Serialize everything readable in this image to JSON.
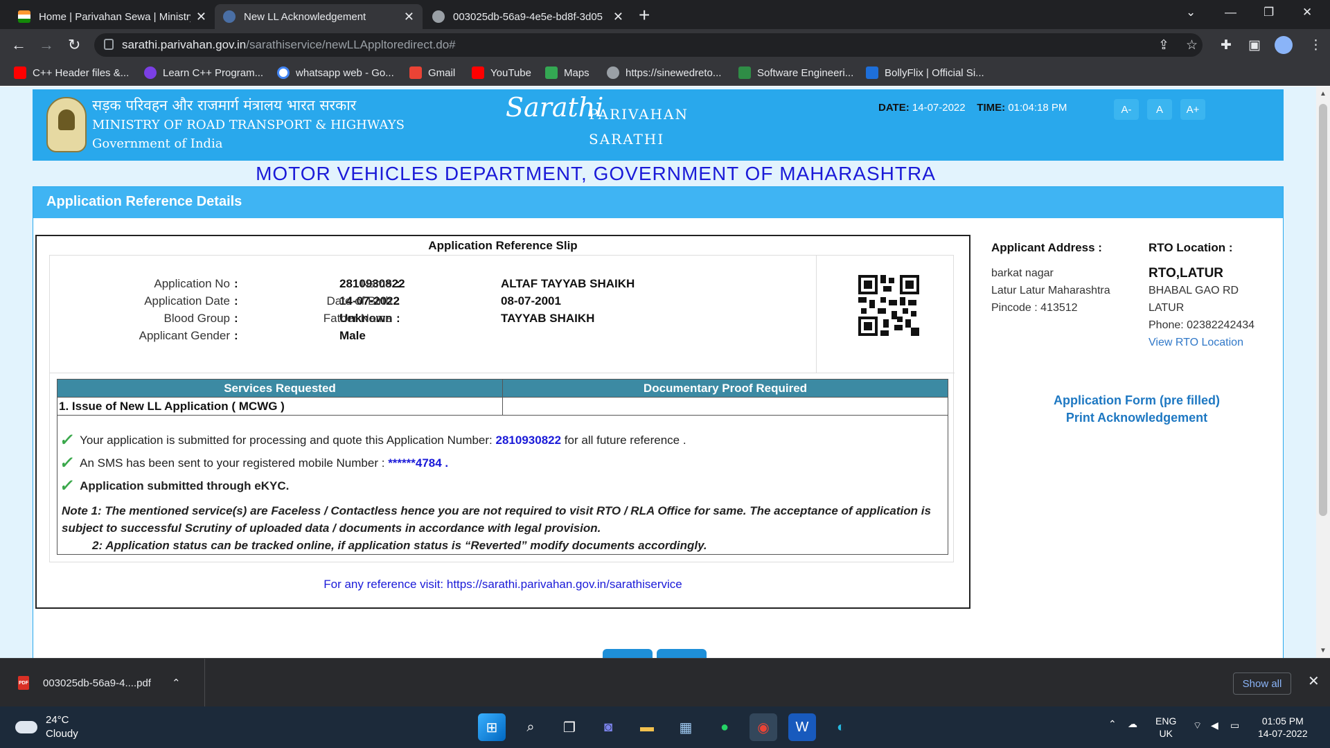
{
  "browser": {
    "tabs": [
      {
        "title": "Home | Parivahan Sewa | Ministry",
        "active": false
      },
      {
        "title": "New LL Acknowledgement",
        "active": true
      },
      {
        "title": "003025db-56a9-4e5e-bd8f-3d05",
        "active": false
      }
    ],
    "url_host": "sarathi.parivahan.gov.in",
    "url_path": "/sarathiservice/newLLAppltoredirect.do#",
    "bookmarks": [
      "C++ Header files &...",
      "Learn C++ Program...",
      "whatsapp web - Go...",
      "Gmail",
      "YouTube",
      "Maps",
      "https://sinewedreto...",
      "Software Engineeri...",
      "BollyFlix | Official Si..."
    ]
  },
  "header": {
    "ministry_hindi": "सड़क परिवहन और राजमार्ग मंत्रालय भारत सरकार",
    "ministry_english": "MINISTRY OF ROAD TRANSPORT & HIGHWAYS",
    "gov": "Government of India",
    "logo_text": "Sarathi",
    "parivahan": "PARIVAHAN",
    "sarathi": "SARATHI",
    "date_label": "DATE:",
    "date_value": "14-07-2022",
    "time_label": "TIME:",
    "time_value": "01:04:18 PM",
    "font_buttons": [
      "A-",
      "A",
      "A+"
    ]
  },
  "dept_title": "MOTOR VEHICLES DEPARTMENT, GOVERNMENT OF MAHARASHTRA",
  "panel_title": "Application Reference Details",
  "slip": {
    "title": "Application Reference Slip",
    "fields": {
      "app_no_label": "Application No",
      "app_no": "2810930822",
      "app_date_label": "Application Date",
      "app_date": "14-07-2022",
      "blood_label": "Blood Group",
      "blood": "Unknown",
      "gender_label": "Applicant Gender",
      "gender": "Male",
      "name_label": "Name",
      "name": "ALTAF TAYYAB SHAIKH",
      "dob_label": "Date of Birth",
      "dob": "08-07-2001",
      "father_label": "Father Name",
      "father": "TAYYAB SHAIKH"
    },
    "table": {
      "headers": [
        "Services Requested",
        "Documentary Proof Required"
      ],
      "rows": [
        [
          "1. Issue of New LL Application ( MCWG )",
          ""
        ]
      ]
    },
    "msg1_pre": "Your application is submitted for processing and quote this Application Number:",
    "msg1_num": "2810930822",
    "msg1_post": "for all future reference .",
    "msg2_pre": "An SMS has been sent to your registered mobile Number :",
    "msg2_num": "******4784 .",
    "msg3": "Application submitted through eKYC.",
    "note1": "Note 1:  The mentioned service(s) are Faceless / Contactless hence you are not required to visit RTO / RLA Office for same. The acceptance of application is subject to successful Scrutiny of uploaded data / documents in accordance with legal provision.",
    "note2": "2:  Application status can be tracked online, if application status is “Reverted” modify documents accordingly.",
    "ref_visit": "For any reference visit: https://sarathi.parivahan.gov.in/sarathiservice"
  },
  "address": {
    "title": "Applicant Address :",
    "line1": "barkat nagar",
    "line2": "Latur Latur Maharashtra",
    "line3": "Pincode : 413512"
  },
  "rto": {
    "title": "RTO Location :",
    "name": "RTO,LATUR",
    "line1": "BHABAL GAO RD",
    "line2": "LATUR",
    "phone": "Phone:  02382242434",
    "view_link": "View RTO Location"
  },
  "links": {
    "form": "Application Form (pre filled)",
    "print": "Print Acknowledgement"
  },
  "download": {
    "file": "003025db-56a9-4....pdf",
    "show_all": "Show all"
  },
  "taskbar": {
    "temp": "24°C",
    "weather": "Cloudy",
    "lang1": "ENG",
    "lang2": "UK",
    "time": "01:05 PM",
    "date": "14-07-2022"
  },
  "colors": {
    "header_blue": "#29a8ec",
    "dept_blue": "#1a1ad8",
    "table_head": "#3c8aa3",
    "check_green": "#3aa84b"
  }
}
